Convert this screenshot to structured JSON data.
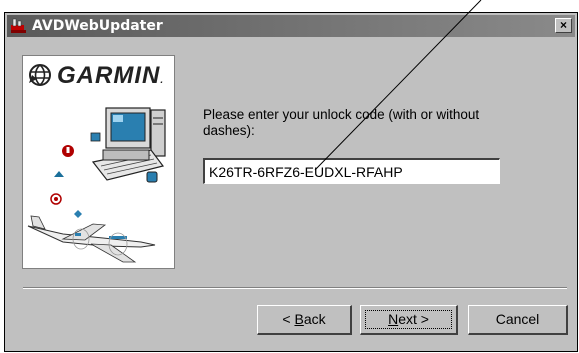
{
  "window": {
    "title": "AVDWebUpdater",
    "close_glyph": "×"
  },
  "branding": {
    "logo_text": "GARMIN",
    "logo_mark": "."
  },
  "main": {
    "prompt": "Please enter your unlock code (with or without dashes):",
    "unlock_code": "K26TR-6RFZ6-EUDXL-RFAHP"
  },
  "buttons": {
    "back_prefix": "< ",
    "back_mnemonic": "B",
    "back_rest": "ack",
    "next_mnemonic": "N",
    "next_rest": "ext >",
    "cancel": "Cancel"
  },
  "icons": {
    "app": "installer-icon",
    "logo": "garmin-globe-icon"
  }
}
